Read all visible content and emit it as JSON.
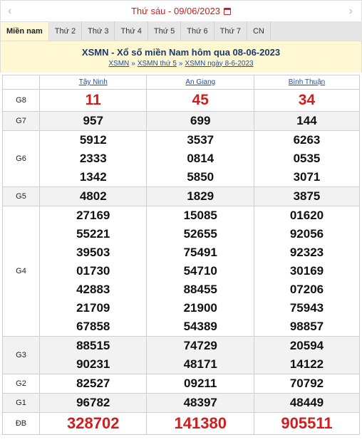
{
  "date_bar": {
    "date_text": "Thứ sáu - 09/06/2023"
  },
  "tabs": [
    {
      "label": "Miền nam"
    },
    {
      "label": "Thứ 2"
    },
    {
      "label": "Thứ 3"
    },
    {
      "label": "Thứ 4"
    },
    {
      "label": "Thứ 5"
    },
    {
      "label": "Thứ 6"
    },
    {
      "label": "Thứ 7"
    },
    {
      "label": "CN"
    }
  ],
  "header": {
    "title": "XSMN - Xổ số miền Nam hôm qua 08-06-2023",
    "crumbs": [
      "XSMN",
      "XSMN thứ 5",
      "XSMN ngày 8-6-2023"
    ],
    "sep": "»"
  },
  "provinces": [
    "Tây Ninh",
    "An Giang",
    "Bình Thuận"
  ],
  "prizes": [
    {
      "label": "G8",
      "rows": [
        [
          "11",
          "45",
          "34"
        ]
      ]
    },
    {
      "label": "G7",
      "rows": [
        [
          "957",
          "699",
          "144"
        ]
      ]
    },
    {
      "label": "G6",
      "rows": [
        [
          "5912",
          "3537",
          "6263"
        ],
        [
          "2333",
          "0814",
          "0535"
        ],
        [
          "1342",
          "5850",
          "3071"
        ]
      ]
    },
    {
      "label": "G5",
      "rows": [
        [
          "4802",
          "1829",
          "3875"
        ]
      ]
    },
    {
      "label": "G4",
      "rows": [
        [
          "27169",
          "15085",
          "01620"
        ],
        [
          "55221",
          "52655",
          "92056"
        ],
        [
          "39503",
          "75491",
          "92323"
        ],
        [
          "01730",
          "54710",
          "30169"
        ],
        [
          "42883",
          "88455",
          "07206"
        ],
        [
          "21709",
          "21900",
          "75943"
        ],
        [
          "67858",
          "54389",
          "98857"
        ]
      ]
    },
    {
      "label": "G3",
      "rows": [
        [
          "88515",
          "74729",
          "20594"
        ],
        [
          "90231",
          "48171",
          "14122"
        ]
      ]
    },
    {
      "label": "G2",
      "rows": [
        [
          "82527",
          "09211",
          "70792"
        ]
      ]
    },
    {
      "label": "G1",
      "rows": [
        [
          "96782",
          "48397",
          "48449"
        ]
      ]
    },
    {
      "label": "ĐB",
      "rows": [
        [
          "328702",
          "141380",
          "905511"
        ]
      ]
    }
  ]
}
